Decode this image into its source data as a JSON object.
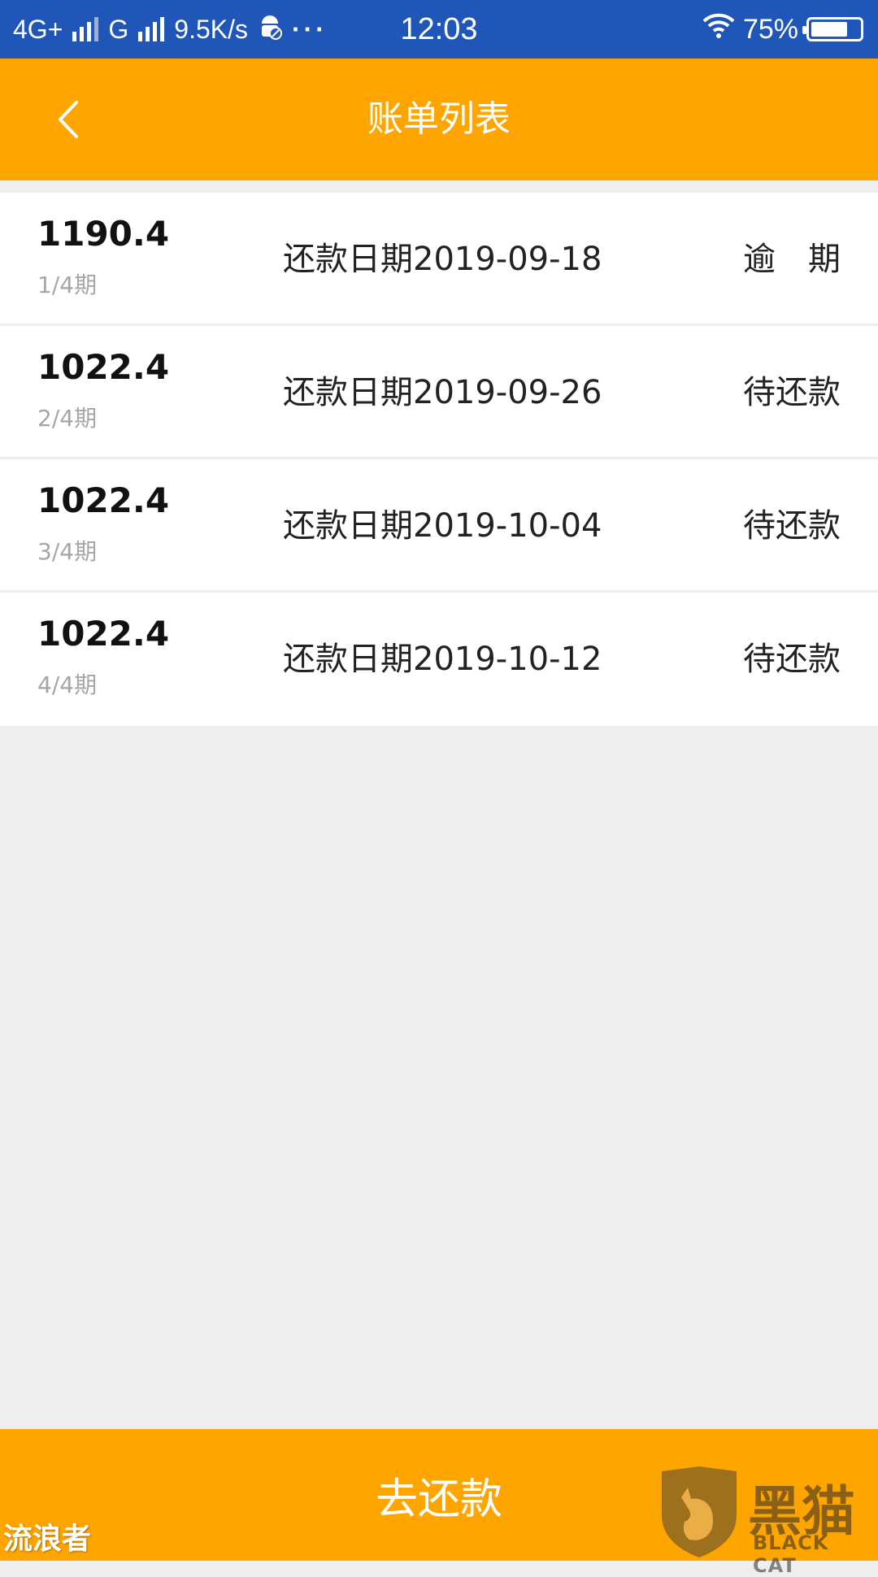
{
  "status_bar": {
    "network1": "4G+",
    "network2": "G",
    "speed": "9.5K/s",
    "more": "···",
    "time": "12:03",
    "battery": "75%",
    "battery_level": 0.75
  },
  "nav": {
    "title": "账单列表",
    "back_icon": "chevron-left-icon"
  },
  "bills": [
    {
      "amount": "1190.4",
      "period": "1/4期",
      "due": "还款日期2019-09-18",
      "status": "逾　期"
    },
    {
      "amount": "1022.4",
      "period": "2/4期",
      "due": "还款日期2019-09-26",
      "status": "待还款"
    },
    {
      "amount": "1022.4",
      "period": "3/4期",
      "due": "还款日期2019-10-04",
      "status": "待还款"
    },
    {
      "amount": "1022.4",
      "period": "4/4期",
      "due": "还款日期2019-10-12",
      "status": "待还款"
    }
  ],
  "footer": {
    "pay_label": "去还款"
  },
  "watermarks": {
    "left": "流浪者",
    "right_cn": "黑猫",
    "right_en": "BLACK CAT"
  },
  "colors": {
    "status_bar": "#1f56b8",
    "accent": "#ffa500",
    "background": "#eeeeee"
  }
}
